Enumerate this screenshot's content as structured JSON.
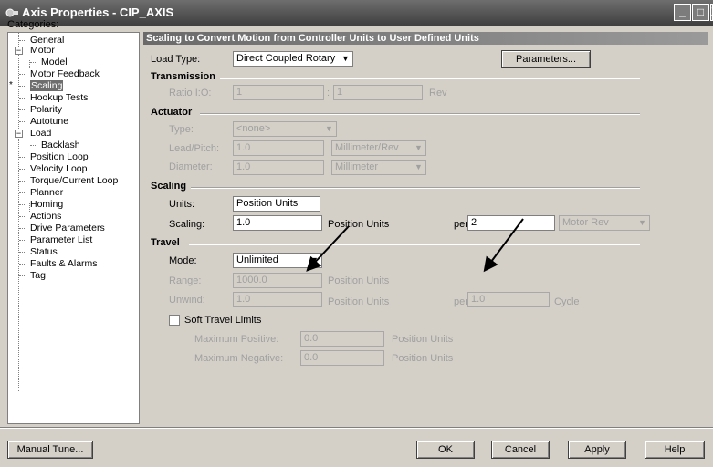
{
  "window": {
    "title": "Axis Properties - CIP_AXIS",
    "icon": "axis-icon",
    "controls": {
      "minimize": "_",
      "maximize": "□",
      "close": "X"
    }
  },
  "categories": {
    "label": "Categories:",
    "items": [
      {
        "label": "General"
      },
      {
        "label": "Motor",
        "expander": "⊟"
      },
      {
        "label": "Model"
      },
      {
        "label": "Motor Feedback"
      },
      {
        "label": "Scaling",
        "selected": true,
        "marker": "*"
      },
      {
        "label": "Hookup Tests"
      },
      {
        "label": "Polarity"
      },
      {
        "label": "Autotune"
      },
      {
        "label": "Load",
        "expander": "⊟"
      },
      {
        "label": "Backlash"
      },
      {
        "label": "Position Loop"
      },
      {
        "label": "Velocity Loop"
      },
      {
        "label": "Torque/Current Loop"
      },
      {
        "label": "Planner"
      },
      {
        "label": "Homing"
      },
      {
        "label": "Actions"
      },
      {
        "label": "Drive Parameters"
      },
      {
        "label": "Parameter List"
      },
      {
        "label": "Status"
      },
      {
        "label": "Faults & Alarms"
      },
      {
        "label": "Tag"
      }
    ]
  },
  "panel": {
    "header": "Scaling to Convert Motion from Controller Units to User Defined Units",
    "load_type": {
      "label": "Load Type:",
      "value": "Direct Coupled Rotary"
    },
    "parameters_button": "Parameters...",
    "transmission": {
      "title": "Transmission",
      "ratio_label": "Ratio I:O:",
      "ratio_in": "1",
      "ratio_sep": ":",
      "ratio_out": "1",
      "ratio_unit": "Rev"
    },
    "actuator": {
      "title": "Actuator",
      "type_label": "Type:",
      "type_value": "<none>",
      "lead_label": "Lead/Pitch:",
      "lead_value": "1.0",
      "lead_unit": "Millimeter/Rev",
      "diameter_label": "Diameter:",
      "diameter_value": "1.0",
      "diameter_unit": "Millimeter"
    },
    "scaling": {
      "title": "Scaling",
      "units_label": "Units:",
      "units_value": "Position Units",
      "scaling_label": "Scaling:",
      "scaling_value": "1.0",
      "scaling_unit": "Position Units",
      "per_label": "per",
      "per_value": "2",
      "per_unit": "Motor Rev"
    },
    "travel": {
      "title": "Travel",
      "mode_label": "Mode:",
      "mode_value": "Unlimited",
      "range_label": "Range:",
      "range_value": "1000.0",
      "range_unit": "Position Units",
      "unwind_label": "Unwind:",
      "unwind_value": "1.0",
      "unwind_unit": "Position Units",
      "unwind_per_label": "per",
      "unwind_per_value": "1.0",
      "unwind_per_unit": "Cycle",
      "soft_limits_label": "Soft Travel Limits",
      "soft_limits_checked": false,
      "max_pos_label": "Maximum Positive:",
      "max_pos_value": "0.0",
      "max_pos_unit": "Position Units",
      "max_neg_label": "Maximum Negative:",
      "max_neg_value": "0.0",
      "max_neg_unit": "Position Units"
    }
  },
  "footer": {
    "manual_tune": "Manual Tune...",
    "ok": "OK",
    "cancel": "Cancel",
    "apply": "Apply",
    "help": "Help"
  }
}
